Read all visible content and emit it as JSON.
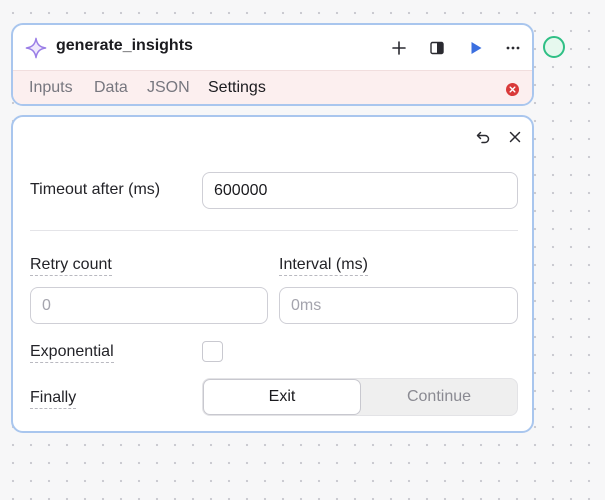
{
  "node": {
    "title": "generate_insights",
    "tabs": [
      "Inputs",
      "Data",
      "JSON",
      "Settings"
    ],
    "active_tab": "Settings"
  },
  "settings": {
    "timeout": {
      "label": "Timeout after (ms)",
      "value": "600000"
    },
    "retry_count": {
      "label": "Retry count",
      "placeholder": "0"
    },
    "interval": {
      "label": "Interval (ms)",
      "placeholder": "0ms"
    },
    "exponential": {
      "label": "Exponential",
      "checked": false
    },
    "finally": {
      "label": "Finally",
      "options": [
        "Exit",
        "Continue"
      ],
      "selected": "Exit"
    }
  },
  "colors": {
    "selection_border": "#a9c6ee",
    "sparkle": "#9a7ee6",
    "run": "#3b6fe0",
    "error": "#d93a3a",
    "status": "#2fbf85",
    "tabs_background": "#fcefef"
  },
  "icons": [
    "sparkle-icon",
    "plus-icon",
    "panel-icon",
    "play-icon",
    "more-icon",
    "error-icon",
    "undo-icon",
    "close-icon"
  ]
}
